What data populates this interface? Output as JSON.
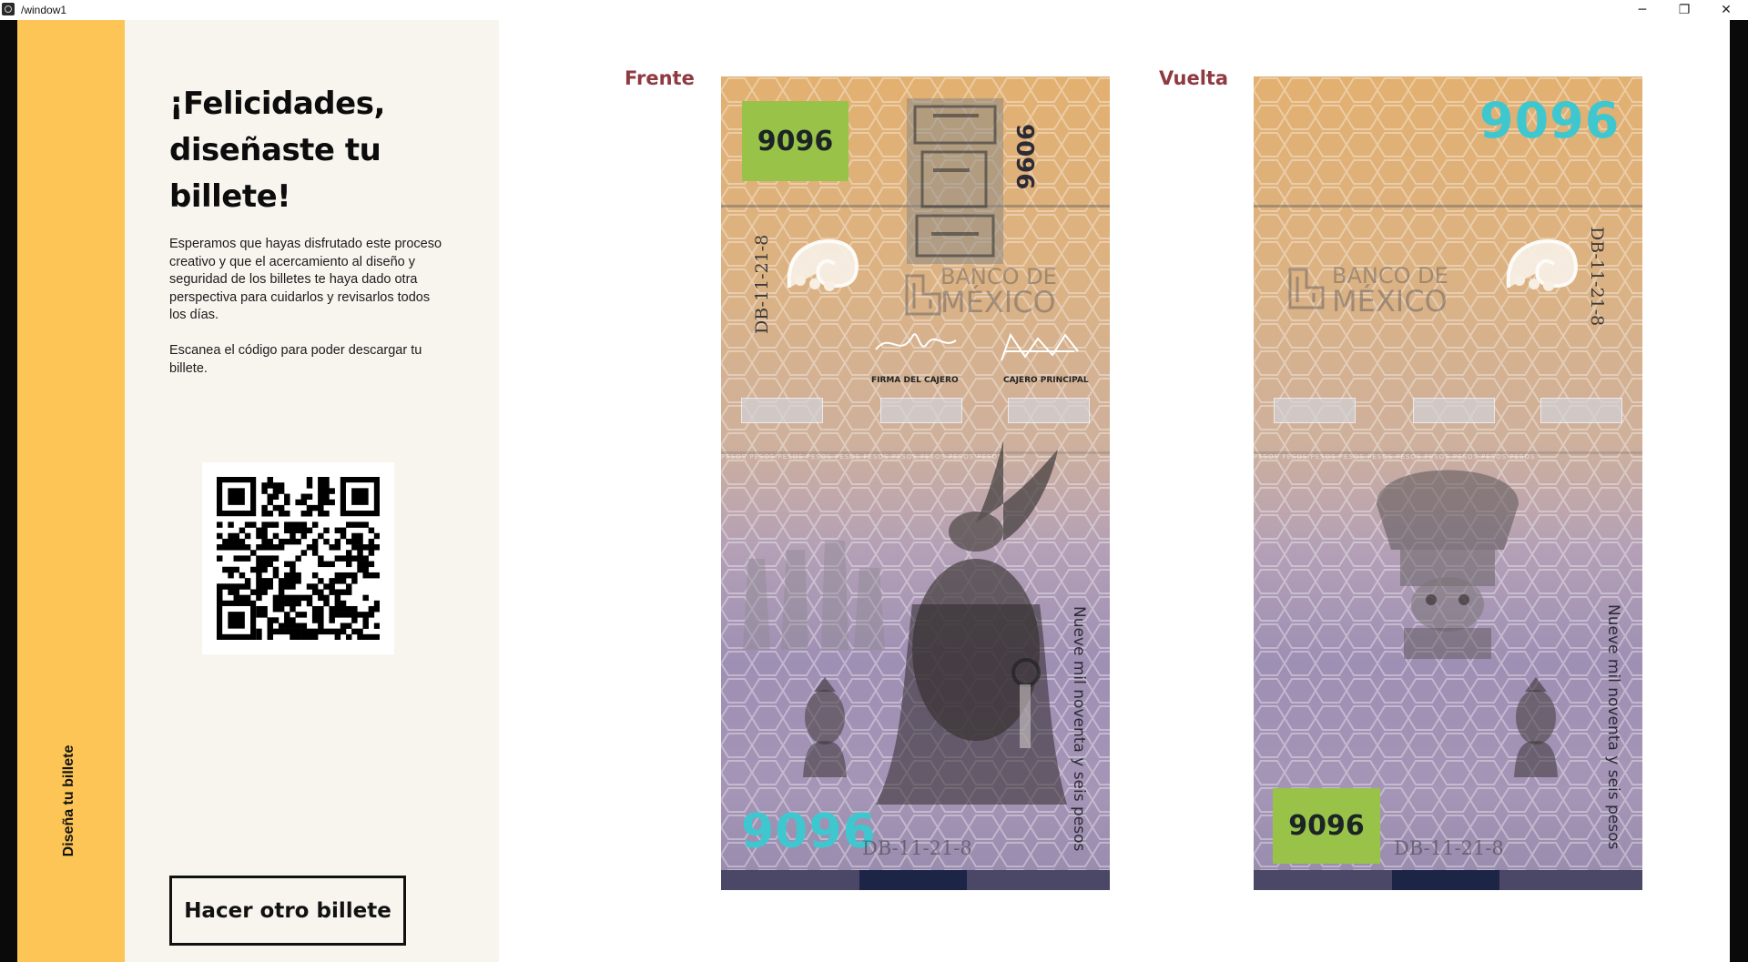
{
  "window": {
    "title": "/window1",
    "minimize_glyph": "─",
    "maximize_glyph": "❐",
    "close_glyph": "✕"
  },
  "rail": {
    "label": "Diseña tu billete"
  },
  "info": {
    "heading": "¡Felicidades, diseñaste tu billete!",
    "paragraph1": "Esperamos que hayas disfrutado este proceso creativo y que el acercamiento al diseño y seguridad de los billetes te haya dado otra perspectiva para cuidarlos y revisarlos todos los días.",
    "paragraph2": "Escanea el código para poder descargar tu billete.",
    "button_label": "Hacer otro billete"
  },
  "bills": {
    "front": {
      "side_label": "Frente",
      "denomination": "9096",
      "serial": "DB-11-21-8",
      "bank_line1": "BANCO DE",
      "bank_line2": "MÉXICO",
      "sig_cashier": "FIRMA DEL CAJERO",
      "sig_principal": "CAJERO PRINCIPAL",
      "amount_text": "Nueve mil noventa y seis pesos",
      "pesos_strip": "PESOS PESOS PESOS PESOS PESOS PESOS PESOS PESOS PESOS PESOS"
    },
    "back": {
      "side_label": "Vuelta",
      "denomination": "9096",
      "serial": "DB-11-21-8",
      "bank_line1": "BANCO DE",
      "bank_line2": "MÉXICO",
      "amount_text": "Nueve mil noventa y seis pesos",
      "pesos_strip": "PESOS PESOS PESOS PESOS PESOS PESOS PESOS PESOS PESOS PESOS"
    }
  },
  "colors": {
    "rail": "#fcc556",
    "panel": "#f8f5ef",
    "side_label": "#8e3a40",
    "denomination_box": "#99c348",
    "denomination_cyan": "#3fc7cf"
  }
}
